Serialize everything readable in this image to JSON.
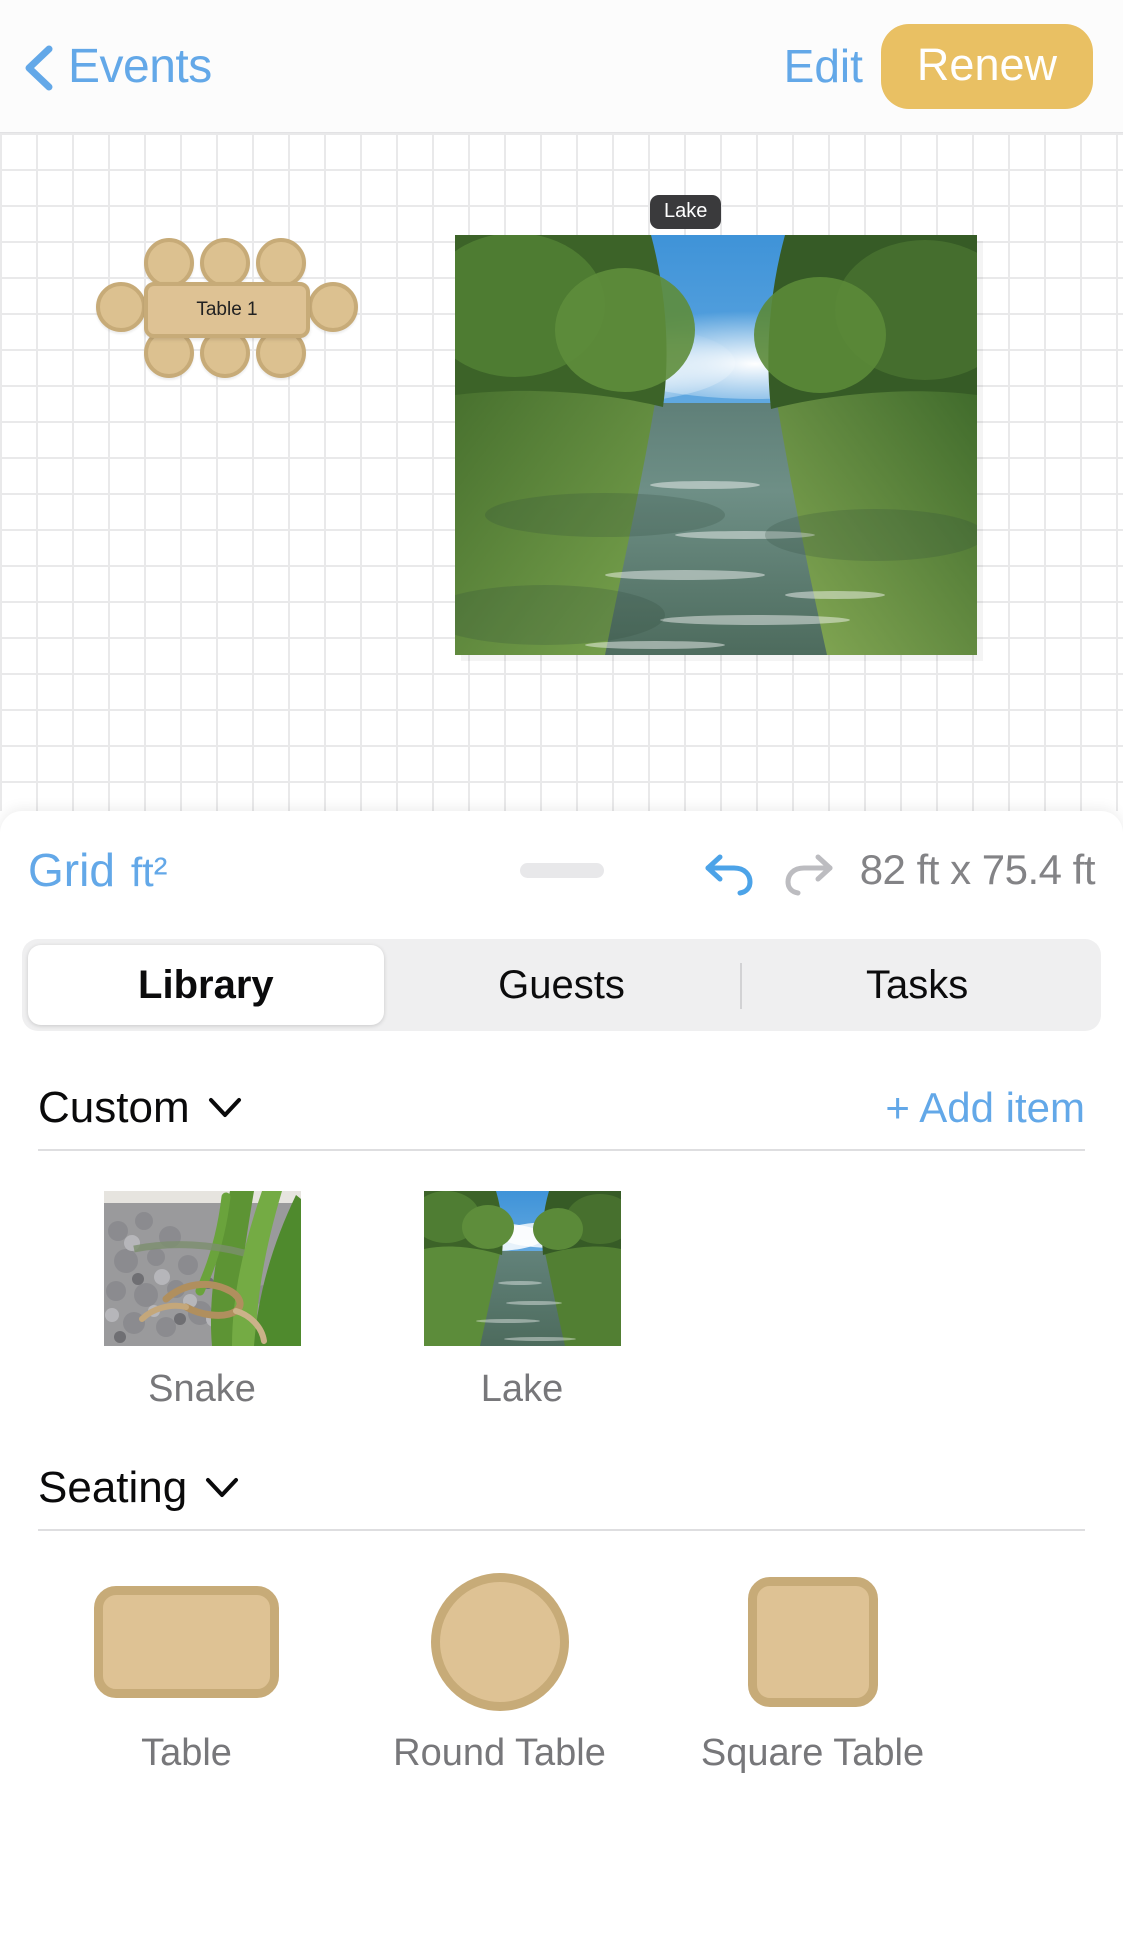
{
  "navbar": {
    "back_label": "Events",
    "back_icon": "chevron-left-icon",
    "edit_label": "Edit",
    "renew_label": "Renew",
    "accent_blue": "#63a8e8",
    "renew_bg": "#e9c063"
  },
  "canvas": {
    "table_object": {
      "label": "Table 1",
      "seat_count": 8,
      "fill": "#dec294",
      "stroke": "#c7ab78"
    },
    "placed_image": {
      "badge_label": "Lake",
      "badge_bg": "#3a3a3c",
      "alt": "river lined with green trees under blue sky"
    },
    "grid_color": "#e9e9ea"
  },
  "toolbar": {
    "grid_label": "Grid",
    "unit_label": "ft²",
    "undo_icon": "undo-arrow-icon",
    "redo_icon": "redo-arrow-icon",
    "undo_color": "#4ca3e8",
    "redo_color": "#bcbcc0",
    "dimensions": "82 ft x 75.4 ft"
  },
  "tabs": [
    {
      "label": "Library",
      "active": true
    },
    {
      "label": "Guests",
      "active": false
    },
    {
      "label": "Tasks",
      "active": false
    }
  ],
  "sections": [
    {
      "title": "Custom",
      "caret_icon": "chevron-down-icon",
      "add_label": "+ Add item",
      "items": [
        {
          "label": "Snake",
          "alt": "snake on grey gravel beside a green yucca plant"
        },
        {
          "label": "Lake",
          "alt": "river lined with green trees under blue sky"
        }
      ]
    },
    {
      "title": "Seating",
      "caret_icon": "chevron-down-icon",
      "shapes": [
        {
          "label": "Table",
          "shape": "rounded-rectangle"
        },
        {
          "label": "Round Table",
          "shape": "circle"
        },
        {
          "label": "Square Table",
          "shape": "rounded-square"
        }
      ]
    }
  ]
}
